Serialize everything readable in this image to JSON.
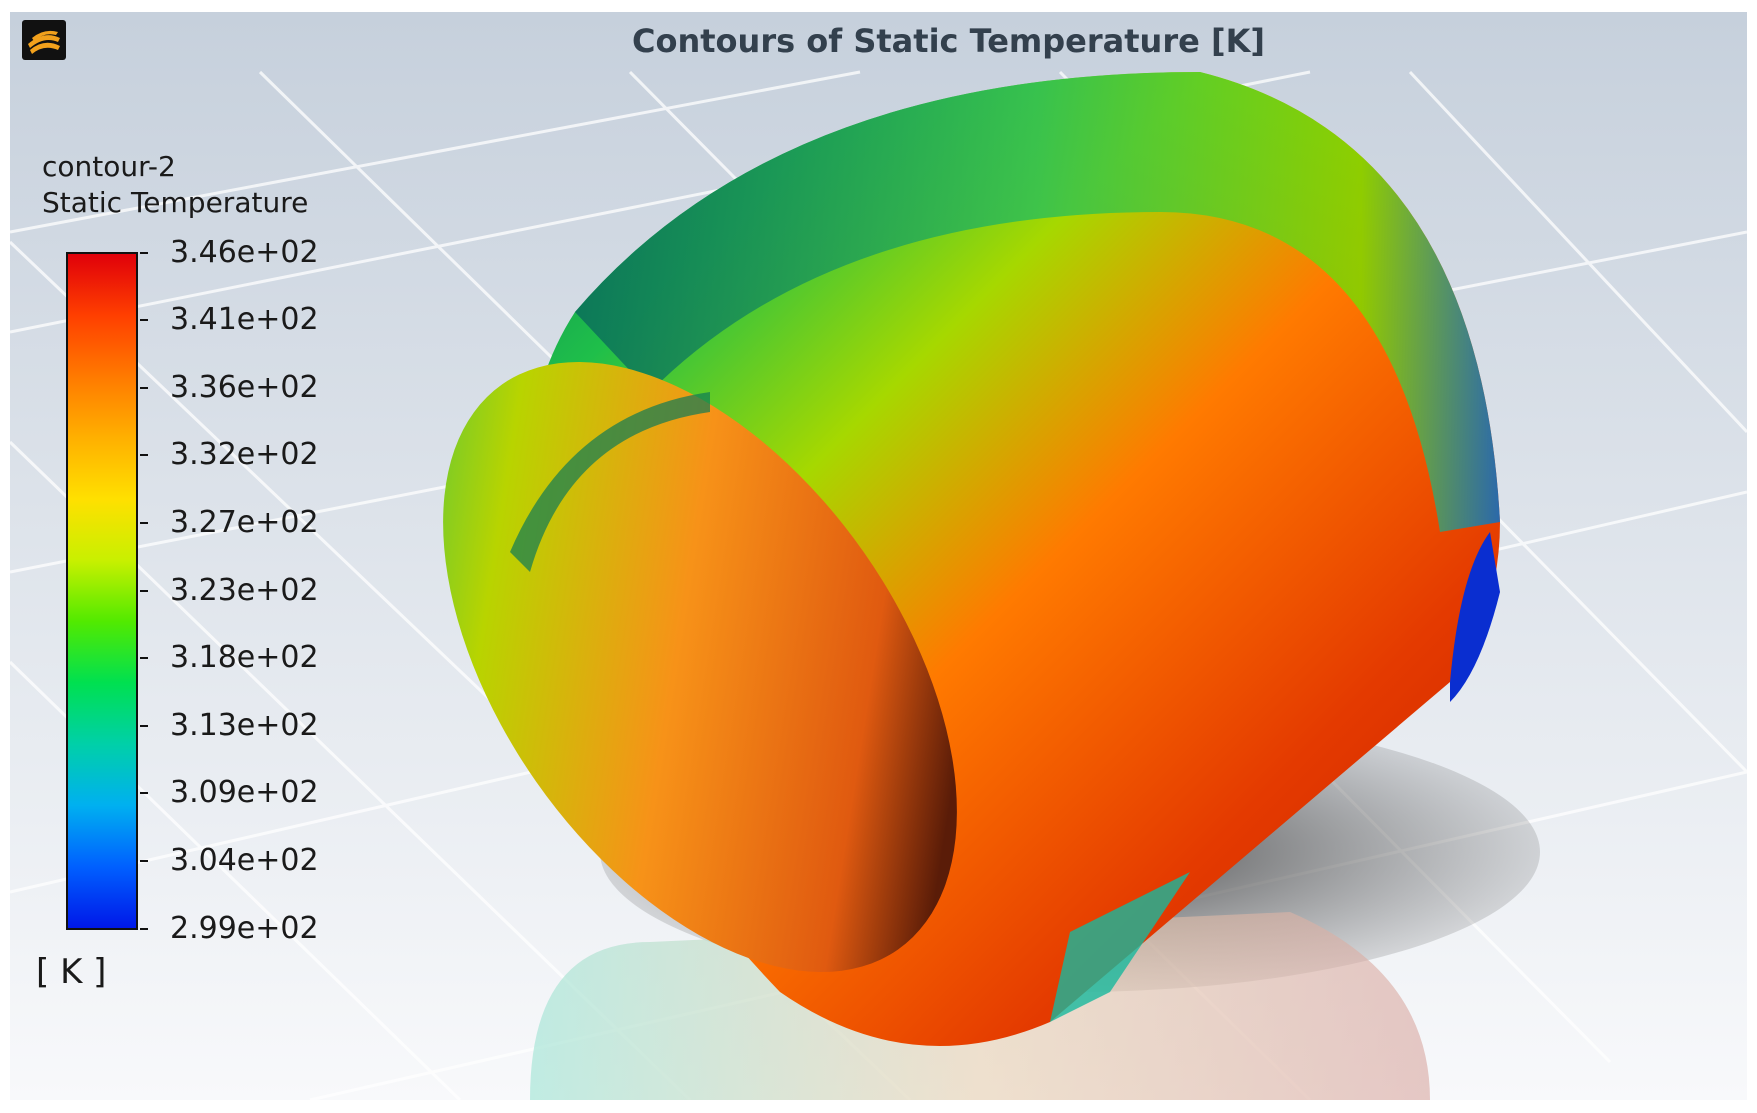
{
  "window": {
    "title": "Contours of Static Temperature [K]",
    "logo_icon": "ansys-fluent-logo-icon"
  },
  "legend": {
    "contour_name": "contour-2",
    "quantity": "Static Temperature",
    "units": "[ K ]",
    "max_label": "3.46e+02",
    "min_label": "2.99e+02",
    "tick_labels": [
      "3.46e+02",
      "3.41e+02",
      "3.36e+02",
      "3.32e+02",
      "3.27e+02",
      "3.23e+02",
      "3.18e+02",
      "3.13e+02",
      "3.09e+02",
      "3.04e+02",
      "2.99e+02"
    ],
    "colormap": [
      "#e0000a",
      "#ff3f00",
      "#ff7a00",
      "#ffb000",
      "#ffe000",
      "#c8f000",
      "#52ea00",
      "#00e050",
      "#00d0a8",
      "#00b0f0",
      "#0060ff",
      "#0018e8"
    ]
  },
  "scene": {
    "object": "cylinder-surface",
    "background_colors": [
      "#c6d0dc",
      "#f8f9fb"
    ]
  }
}
